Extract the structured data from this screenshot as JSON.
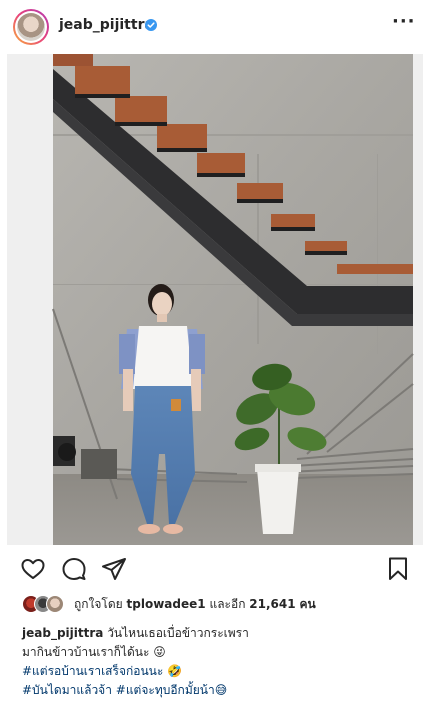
{
  "post": {
    "username": "jeab_pijittra",
    "more_label": "···",
    "likes_prefix": "ถูกใจโดย",
    "liked_by": "tplowadee1",
    "likes_middle": "และอีก",
    "likes_count": "21,641",
    "likes_suffix": "คน",
    "caption": {
      "username": "jeab_pijittra",
      "line1": "วันไหนเธอเบื่อข้าวกระเพรา",
      "line2": "มากินข้าวบ้านเราก็ได้นะ 😜",
      "line3": "#แต่รอบ้านเราเสร็จก่อนนะ 🤣",
      "line4": "#บันไดมาแล้วจ้า #แต่จะทุบอีกมั้ยน้า😅"
    }
  },
  "icons": {
    "verified": "verified-badge-icon",
    "more": "more-options-icon",
    "like": "heart-icon",
    "comment": "comment-bubble-icon",
    "share": "paper-plane-icon",
    "save": "bookmark-icon"
  },
  "colors": {
    "text": "#262626",
    "verified": "#3897f0",
    "hashtag": "#00376b",
    "background": "#ffffff"
  }
}
